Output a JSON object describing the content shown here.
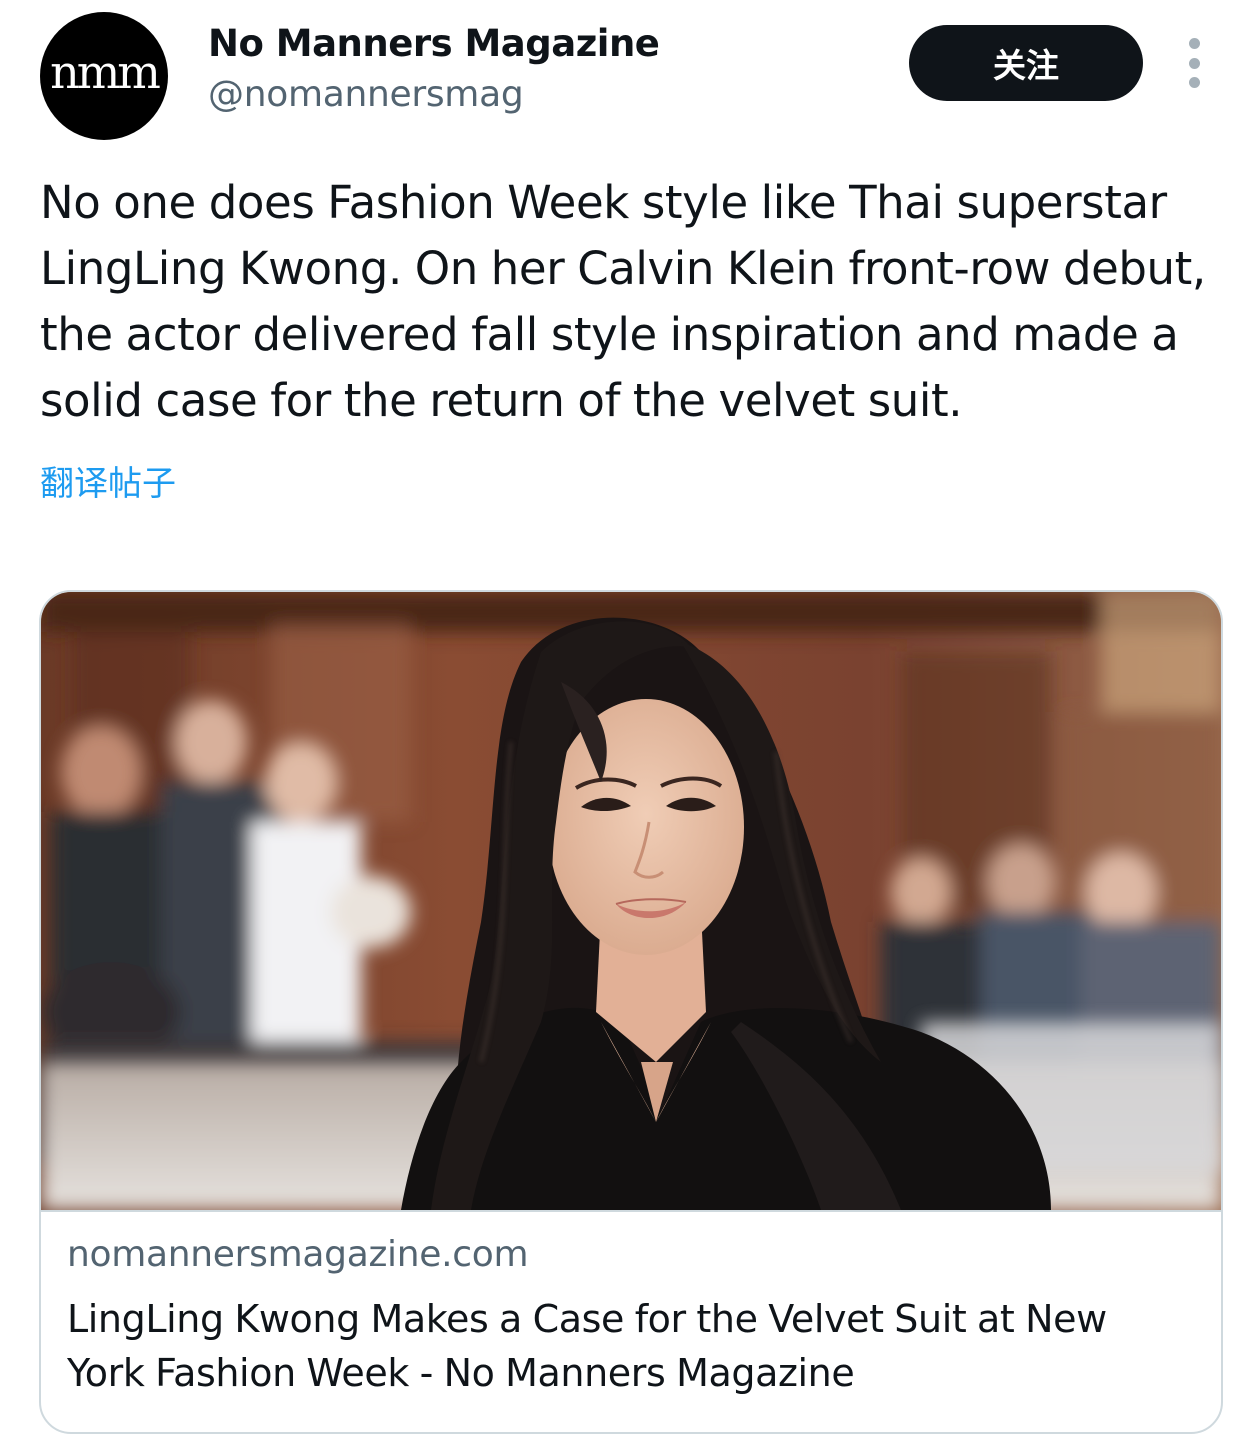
{
  "post": {
    "author": {
      "avatar_text": "nmm",
      "display_name": "No Manners Magazine",
      "handle": "@nomannersmag"
    },
    "follow_label": "关注",
    "more_icon": "more-vertical-icon",
    "text": "No one does Fashion Week style like Thai superstar LingLing Kwong. On her Calvin Klein front-row debut, the actor delivered fall style inspiration and made a solid case for the return of the velvet suit.",
    "translate_label": "翻译帖子"
  },
  "link_card": {
    "image": "photo of a smiling woman with long dark wavy hair in a black velvet suit, blurred crowd and brick building behind",
    "domain": "nomannersmagazine.com",
    "title": "LingLing Kwong Makes a Case for the Velvet Suit at New York Fashion Week - No Manners Magazine"
  },
  "colors": {
    "text_primary": "#0f1419",
    "text_secondary": "#536471",
    "link": "#1d9bf0",
    "button_bg": "#0f1419",
    "border": "#cfd9de"
  }
}
